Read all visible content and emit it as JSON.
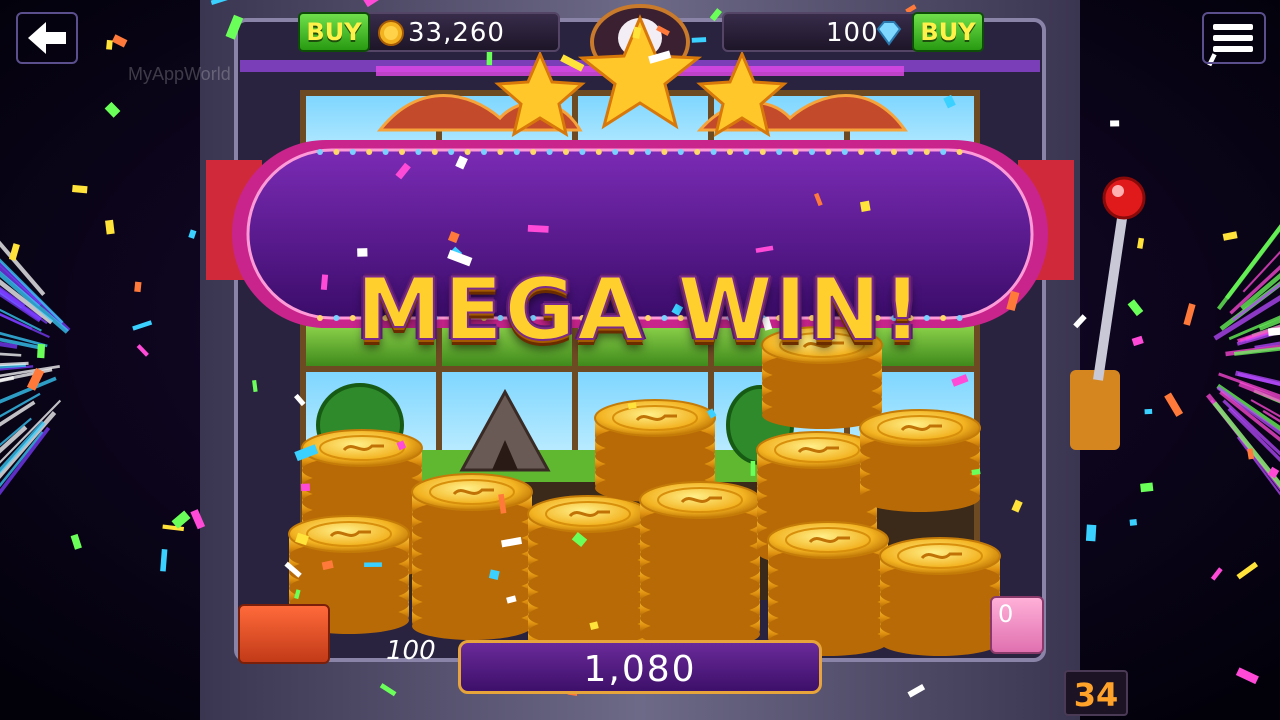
{
  "hud": {
    "coins_buy_label": "BUY",
    "coins_value": "33,260",
    "gems_value": "100",
    "gems_buy_label": "BUY"
  },
  "watermark": "MyAppWorld",
  "banner": {
    "title": "MEGA WIN!"
  },
  "win": {
    "amount": "1,080"
  },
  "bet": {
    "left_value": "100",
    "right_value": "0"
  },
  "level": {
    "value": "34"
  },
  "colors": {
    "banner_purple": "#5a1a8a",
    "gold": "#ffcf2e",
    "buy_green": "#3fbf1a",
    "accent_orange": "#ffa22a"
  },
  "icons": [
    "back-arrow-icon",
    "hamburger-menu-icon",
    "coin-icon",
    "diamond-icon",
    "star-icon",
    "lever-icon"
  ]
}
